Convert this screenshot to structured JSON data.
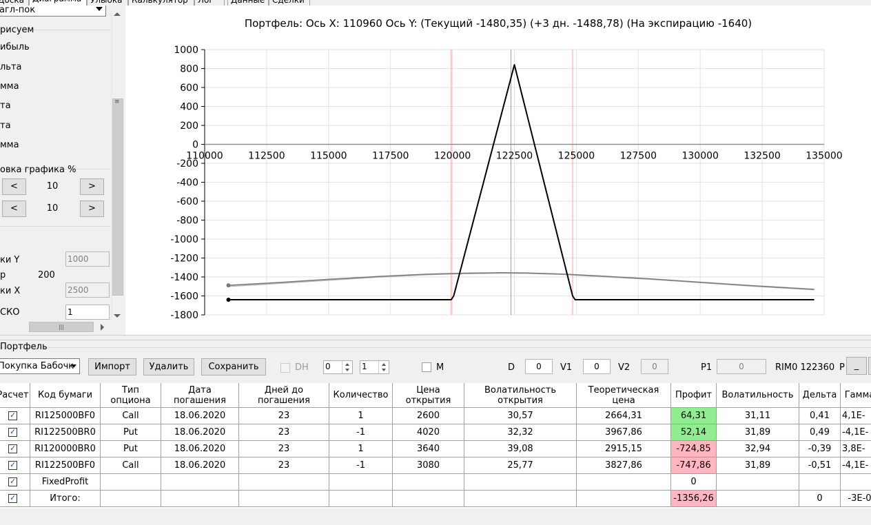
{
  "tabs": [
    {
      "label": "Доска",
      "active": false
    },
    {
      "label": "Диаграмма",
      "active": true
    },
    {
      "label": "Улыбка",
      "active": false
    },
    {
      "label": "Калькулятор",
      "active": false
    },
    {
      "label": "Лог",
      "active": false
    },
    {
      "label": "Данные",
      "active": false
    },
    {
      "label": "Сделки",
      "active": false
    }
  ],
  "left": {
    "combo_value": "агл-пок",
    "group_draw": "рисуем",
    "draw_items": [
      "ибыль",
      "льта",
      "мма",
      "та",
      "та",
      "мма"
    ],
    "group_shift": "овка графика %",
    "step1": "10",
    "step2": "10",
    "prev_label": "<",
    "next_label": ">",
    "ticks_y_label": "ки Y",
    "ticks_y_value": "1000",
    "p_label": "р",
    "p_value": "200",
    "ticks_x_label": "ки X",
    "ticks_x_value": "2500",
    "sko_label": "СКО",
    "sko_value": "1"
  },
  "chart_title": "Портфель: Ось X: 110960 Ось Y:  (Текущий -1480,35)  (+3 дн. -1488,78)  (На экспирацию -1640)",
  "chart_data": {
    "type": "line",
    "xlim": [
      110000,
      135000
    ],
    "ylim": [
      -1800,
      1000
    ],
    "x_ticks": [
      "110000",
      "112500",
      "115000",
      "117500",
      "120000",
      "122500",
      "125000",
      "127500",
      "130000",
      "132500",
      "135000"
    ],
    "y_ticks": [
      "1000",
      "800",
      "600",
      "400",
      "200",
      "0",
      "-200",
      "-400",
      "-600",
      "-800",
      "-1000",
      "-1200",
      "-1400",
      "-1600",
      "-1800"
    ],
    "grid": true,
    "vlines": [
      {
        "x": 119950,
        "color": "#ff9a9a"
      },
      {
        "x": 122360,
        "color": "#8a9ac8"
      },
      {
        "x": 124850,
        "color": "#ff9a9a"
      }
    ],
    "series": [
      {
        "color": "#000000",
        "x": [
          110960,
          119950,
          120050,
          122500,
          124850,
          124950,
          134600
        ],
        "y": [
          -1640,
          -1640,
          -1600,
          840,
          -1600,
          -1640,
          -1640
        ]
      },
      {
        "color": "#7a7a7a",
        "x": [
          110960,
          113000,
          115000,
          117000,
          119000,
          120500,
          122000,
          123000,
          124500,
          126000,
          128000,
          130000,
          132000,
          134600
        ],
        "y": [
          -1488,
          -1458,
          -1425,
          -1395,
          -1370,
          -1360,
          -1355,
          -1357,
          -1370,
          -1390,
          -1420,
          -1455,
          -1490,
          -1530
        ]
      },
      {
        "color": "#b4b4b4",
        "x": [
          110960,
          113000,
          115000,
          117000,
          119000,
          120500,
          122000,
          123000,
          124500,
          126000,
          128000,
          130000,
          132000,
          134600
        ],
        "y": [
          -1500,
          -1468,
          -1434,
          -1402,
          -1376,
          -1365,
          -1360,
          -1362,
          -1374,
          -1396,
          -1425,
          -1460,
          -1495,
          -1535
        ]
      }
    ],
    "markers": [
      {
        "x": 110960,
        "y": -1488,
        "color": "#7a7a7a"
      },
      {
        "x": 110960,
        "y": -1640,
        "color": "#000000"
      }
    ]
  },
  "portfolio": {
    "group_label": "Портфель",
    "strategy": "Покупка Бабочк",
    "import_label": "Импорт",
    "delete_label": "Удалить",
    "save_label": "Сохранить",
    "dh_label": "DH",
    "spin1": "0",
    "spin2": "1",
    "m_label": "M",
    "d_label": "D",
    "d_value": "0",
    "v1_label": "V1",
    "v1_value": "0",
    "v2_label": "V2",
    "v2_value": "0",
    "p1_label": "P1",
    "p1_value": "0",
    "rim_label": "RIM0 122360",
    "p_trunc": "P",
    "min_button": "_"
  },
  "table": {
    "headers": [
      "Расчет",
      "Код бумаги",
      "Тип опциона",
      "Дата погашения",
      "Дней до погашения",
      "Количество",
      "Цена открытия",
      "Волатильность открытия",
      "Теоретическая цена",
      "Профит",
      "Волатильность",
      "Дельта",
      "Гамма"
    ],
    "rows": [
      {
        "code": "RI125000BF0",
        "type": "Call",
        "date": "18.06.2020",
        "days": "23",
        "qty": "1",
        "open": "2600",
        "vol_open": "30,57",
        "theo": "2664,31",
        "profit": "64,31",
        "profit_color": "#90ee90",
        "vol": "31,11",
        "delta": "0,41",
        "gamma": "4,1E-"
      },
      {
        "code": "RI122500BR0",
        "type": "Put",
        "date": "18.06.2020",
        "days": "23",
        "qty": "-1",
        "open": "4020",
        "vol_open": "32,32",
        "theo": "3967,86",
        "profit": "52,14",
        "profit_color": "#90ee90",
        "vol": "31,89",
        "delta": "0,49",
        "gamma": "-4,1E-"
      },
      {
        "code": "RI120000BR0",
        "type": "Put",
        "date": "18.06.2020",
        "days": "23",
        "qty": "1",
        "open": "3640",
        "vol_open": "39,08",
        "theo": "2915,15",
        "profit": "-724,85",
        "profit_color": "#ffb6c1",
        "vol": "32,94",
        "delta": "-0,39",
        "gamma": "3,8E-"
      },
      {
        "code": "RI122500BF0",
        "type": "Call",
        "date": "18.06.2020",
        "days": "23",
        "qty": "-1",
        "open": "3080",
        "vol_open": "25,77",
        "theo": "3827,86",
        "profit": "-747,86",
        "profit_color": "#ffb6c1",
        "vol": "31,89",
        "delta": "-0,51",
        "gamma": "-4,1E-"
      }
    ],
    "fixed_label": "FixedProfit",
    "fixed_value": "0",
    "total_label": "Итого:",
    "total_profit": "-1356,26",
    "total_profit_color": "#ffb6c1",
    "total_delta": "0",
    "total_gamma": "-3E-0"
  }
}
